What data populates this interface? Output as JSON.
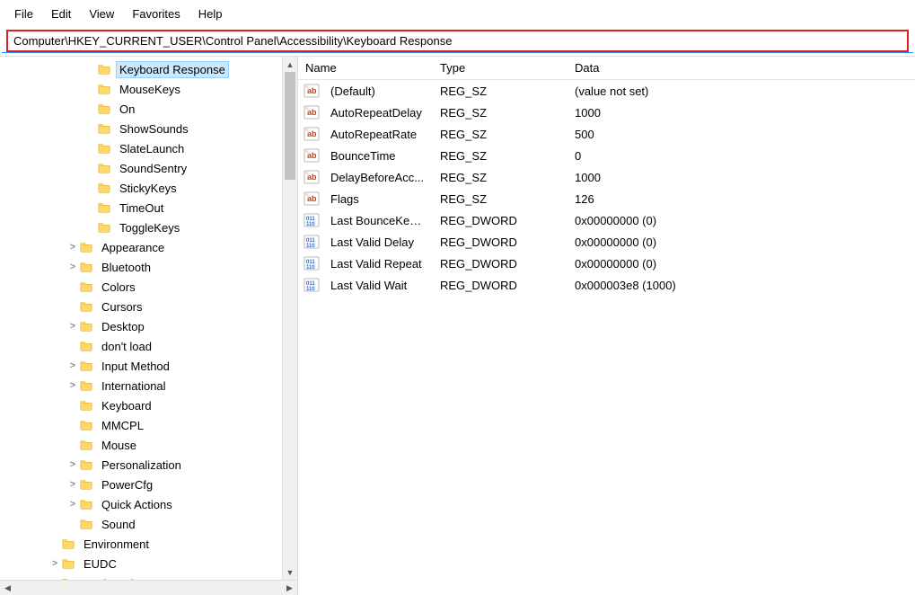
{
  "menu": {
    "items": [
      "File",
      "Edit",
      "View",
      "Favorites",
      "Help"
    ]
  },
  "address": "Computer\\HKEY_CURRENT_USER\\Control Panel\\Accessibility\\Keyboard Response",
  "tree": [
    {
      "indent": 4,
      "tw": "",
      "label": "Keyboard Response",
      "selected": true
    },
    {
      "indent": 4,
      "tw": "",
      "label": "MouseKeys"
    },
    {
      "indent": 4,
      "tw": "",
      "label": "On"
    },
    {
      "indent": 4,
      "tw": "",
      "label": "ShowSounds"
    },
    {
      "indent": 4,
      "tw": "",
      "label": "SlateLaunch"
    },
    {
      "indent": 4,
      "tw": "",
      "label": "SoundSentry"
    },
    {
      "indent": 4,
      "tw": "",
      "label": "StickyKeys"
    },
    {
      "indent": 4,
      "tw": "",
      "label": "TimeOut"
    },
    {
      "indent": 4,
      "tw": "",
      "label": "ToggleKeys"
    },
    {
      "indent": 3,
      "tw": ">",
      "label": "Appearance"
    },
    {
      "indent": 3,
      "tw": ">",
      "label": "Bluetooth"
    },
    {
      "indent": 3,
      "tw": "",
      "label": "Colors"
    },
    {
      "indent": 3,
      "tw": "",
      "label": "Cursors"
    },
    {
      "indent": 3,
      "tw": ">",
      "label": "Desktop"
    },
    {
      "indent": 3,
      "tw": "",
      "label": "don't load"
    },
    {
      "indent": 3,
      "tw": ">",
      "label": "Input Method"
    },
    {
      "indent": 3,
      "tw": ">",
      "label": "International"
    },
    {
      "indent": 3,
      "tw": "",
      "label": "Keyboard"
    },
    {
      "indent": 3,
      "tw": "",
      "label": "MMCPL"
    },
    {
      "indent": 3,
      "tw": "",
      "label": "Mouse"
    },
    {
      "indent": 3,
      "tw": ">",
      "label": "Personalization"
    },
    {
      "indent": 3,
      "tw": ">",
      "label": "PowerCfg"
    },
    {
      "indent": 3,
      "tw": ">",
      "label": "Quick Actions"
    },
    {
      "indent": 3,
      "tw": "",
      "label": "Sound"
    },
    {
      "indent": 2,
      "tw": "",
      "label": "Environment"
    },
    {
      "indent": 2,
      "tw": ">",
      "label": "EUDC"
    },
    {
      "indent": 2,
      "tw": ">",
      "label": "Keyboard Layout"
    }
  ],
  "columns": {
    "name": "Name",
    "type": "Type",
    "data": "Data"
  },
  "values": [
    {
      "icon": "sz",
      "name": "(Default)",
      "type": "REG_SZ",
      "data": "(value not set)"
    },
    {
      "icon": "sz",
      "name": "AutoRepeatDelay",
      "type": "REG_SZ",
      "data": "1000"
    },
    {
      "icon": "sz",
      "name": "AutoRepeatRate",
      "type": "REG_SZ",
      "data": "500"
    },
    {
      "icon": "sz",
      "name": "BounceTime",
      "type": "REG_SZ",
      "data": "0"
    },
    {
      "icon": "sz",
      "name": "DelayBeforeAcc...",
      "type": "REG_SZ",
      "data": "1000"
    },
    {
      "icon": "sz",
      "name": "Flags",
      "type": "REG_SZ",
      "data": "126"
    },
    {
      "icon": "dw",
      "name": "Last BounceKey ...",
      "type": "REG_DWORD",
      "data": "0x00000000 (0)"
    },
    {
      "icon": "dw",
      "name": "Last Valid Delay",
      "type": "REG_DWORD",
      "data": "0x00000000 (0)"
    },
    {
      "icon": "dw",
      "name": "Last Valid Repeat",
      "type": "REG_DWORD",
      "data": "0x00000000 (0)"
    },
    {
      "icon": "dw",
      "name": "Last Valid Wait",
      "type": "REG_DWORD",
      "data": "0x000003e8 (1000)"
    }
  ]
}
